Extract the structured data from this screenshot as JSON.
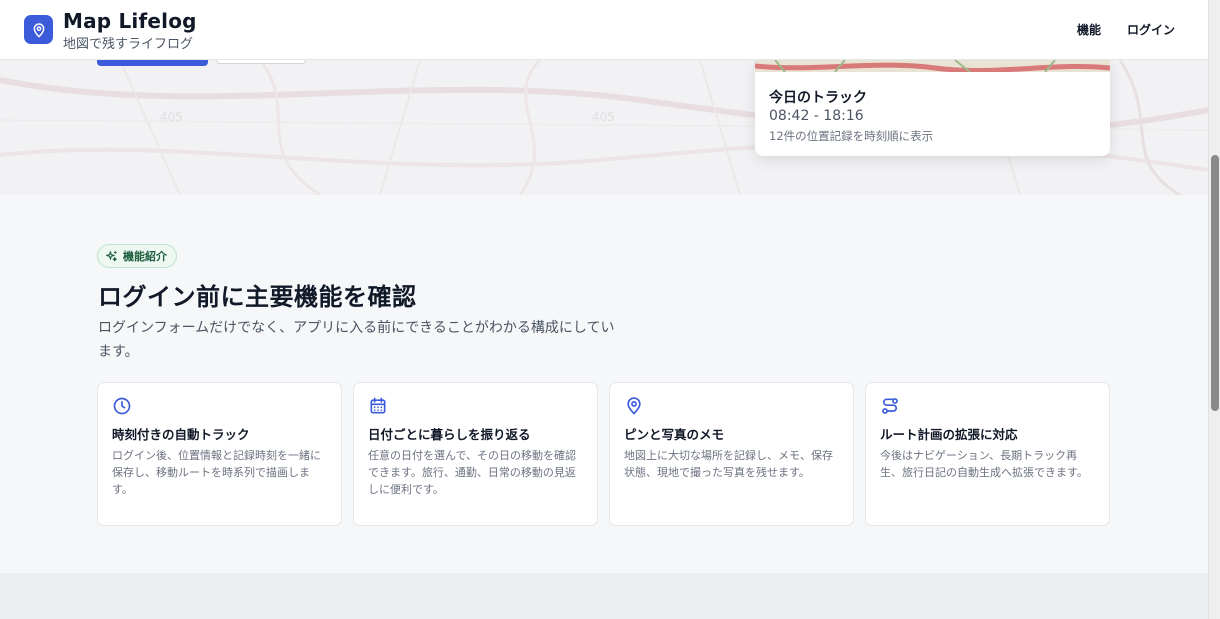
{
  "header": {
    "app_title": "Map Lifelog",
    "app_subtitle": "地図で残すライフログ",
    "nav": [
      {
        "label": "機能"
      },
      {
        "label": "ログイン"
      }
    ]
  },
  "hero": {
    "map_labels": [
      "405",
      "405"
    ],
    "track_card": {
      "title": "今日のトラック",
      "time_range": "08:42 - 18:16",
      "note": "12件の位置記録を時刻順に表示"
    }
  },
  "features": {
    "badge": "機能紹介",
    "title": "ログイン前に主要機能を確認",
    "description": "ログインフォームだけでなく、アプリに入る前にできることがわかる構成にしています。",
    "cards": [
      {
        "icon": "clock-icon",
        "title": "時刻付きの自動トラック",
        "description": "ログイン後、位置情報と記録時刻を一緒に保存し、移動ルートを時系列で描画します。"
      },
      {
        "icon": "calendar-icon",
        "title": "日付ごとに暮らしを振り返る",
        "description": "任意の日付を選んで、その日の移動を確認できます。旅行、通勤、日常の移動の見返しに便利です。"
      },
      {
        "icon": "map-pin-icon",
        "title": "ピンと写真のメモ",
        "description": "地図上に大切な場所を記録し、メモ、保存状態、現地で撮った写真を残せます。"
      },
      {
        "icon": "route-icon",
        "title": "ルート計画の拡張に対応",
        "description": "今後はナビゲーション、長期トラック再生、旅行日記の自動生成へ拡張できます。"
      }
    ]
  },
  "colors": {
    "accent": "#3b5bdb",
    "badge_bg": "#ecf8f1",
    "badge_text": "#1f5f40"
  }
}
